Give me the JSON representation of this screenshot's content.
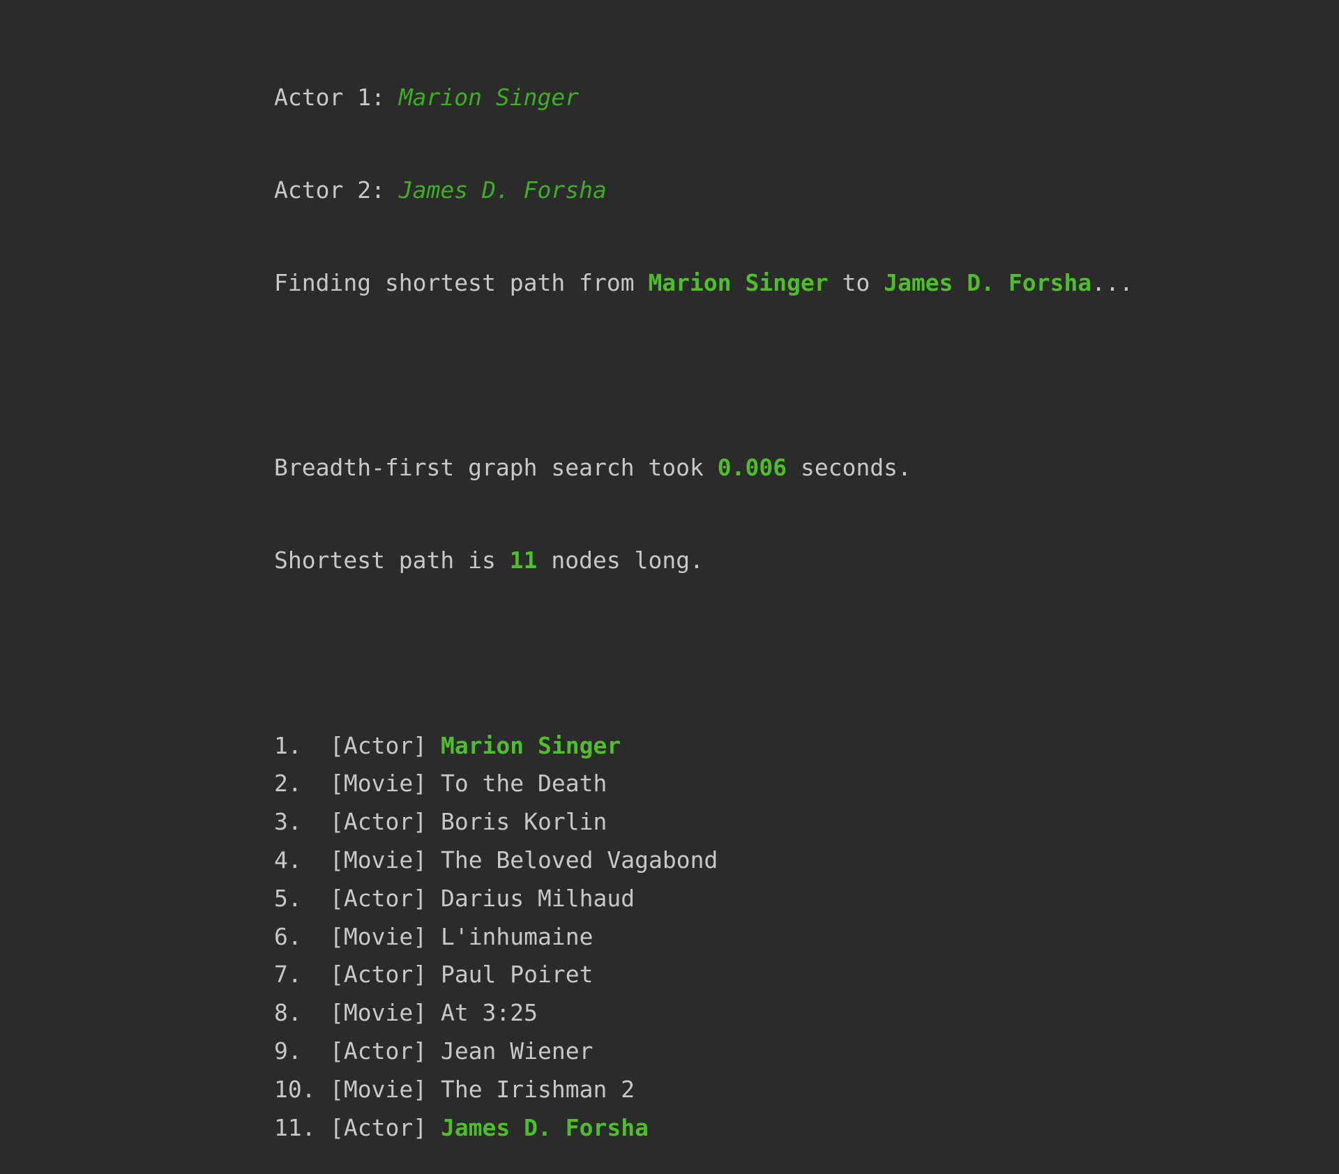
{
  "header": {
    "actor1_label": "Actor 1: ",
    "actor1_value": "Marion Singer",
    "actor2_label": "Actor 2: ",
    "actor2_value": "James D. Forsha",
    "finding_prefix": "Finding shortest path from ",
    "finding_from": "Marion Singer",
    "finding_mid": " to ",
    "finding_to": "James D. Forsha",
    "finding_suffix": "..."
  },
  "stats": {
    "search_prefix": "Breadth-first graph search took ",
    "search_time": "0.006",
    "search_suffix": " seconds.",
    "path_prefix": "Shortest path is ",
    "path_length": "11",
    "path_suffix": " nodes long."
  },
  "path": [
    {
      "num": "1.",
      "type": "[Actor]",
      "name": "Marion Singer",
      "highlight": true
    },
    {
      "num": "2.",
      "type": "[Movie]",
      "name": "To the Death",
      "highlight": false
    },
    {
      "num": "3.",
      "type": "[Actor]",
      "name": "Boris Korlin",
      "highlight": false
    },
    {
      "num": "4.",
      "type": "[Movie]",
      "name": "The Beloved Vagabond",
      "highlight": false
    },
    {
      "num": "5.",
      "type": "[Actor]",
      "name": "Darius Milhaud",
      "highlight": false
    },
    {
      "num": "6.",
      "type": "[Movie]",
      "name": "L'inhumaine",
      "highlight": false
    },
    {
      "num": "7.",
      "type": "[Actor]",
      "name": "Paul Poiret",
      "highlight": false
    },
    {
      "num": "8.",
      "type": "[Movie]",
      "name": "At 3:25",
      "highlight": false
    },
    {
      "num": "9.",
      "type": "[Actor]",
      "name": "Jean Wiener",
      "highlight": false
    },
    {
      "num": "10.",
      "type": "[Movie]",
      "name": "The Irishman 2",
      "highlight": false
    },
    {
      "num": "11.",
      "type": "[Actor]",
      "name": "James D. Forsha",
      "highlight": true
    }
  ],
  "colors": {
    "background": "#2b2b2b",
    "text": "#c8c8c8",
    "accent": "#4ebf2a"
  }
}
